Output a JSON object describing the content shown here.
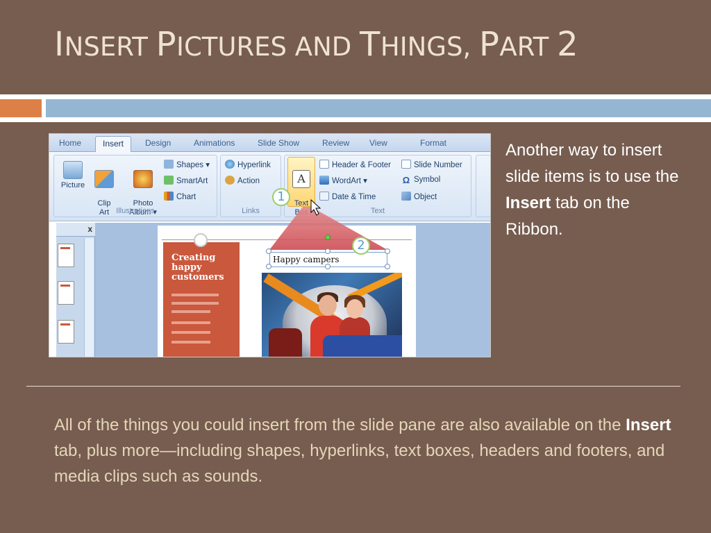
{
  "slide": {
    "title_parts": [
      {
        "big": "I",
        "small": "nsert "
      },
      {
        "big": "P",
        "small": "ictures and "
      },
      {
        "big": "T",
        "small": "hings, "
      },
      {
        "big": "P",
        "small": "art "
      },
      {
        "big": "2",
        "small": ""
      }
    ],
    "right_text": {
      "before": "Another way to insert slide items is to use the ",
      "bold": "Insert",
      "after": " tab on the Ribbon."
    },
    "bottom_text": {
      "before": "All of the things you could insert from the slide pane are also available on the ",
      "bold": "Insert",
      "after": " tab, plus more—including shapes, hyperlinks, text boxes, headers and footers, and media clips such as sounds."
    }
  },
  "screenshot": {
    "tabs": [
      "Home",
      "Insert",
      "Design",
      "Animations",
      "Slide Show",
      "Review",
      "View",
      "Format"
    ],
    "active_tab": "Insert",
    "groups": {
      "illustrations": {
        "label": "Illustrations",
        "buttons": [
          "Picture",
          "Clip\nArt",
          "Photo\nAlbum ▾"
        ],
        "small": [
          "Shapes ▾",
          "SmartArt",
          "Chart"
        ]
      },
      "links": {
        "label": "Links",
        "small": [
          "Hyperlink",
          "Action"
        ]
      },
      "text": {
        "label": "Text",
        "button": "Text\nBox",
        "small_col1": [
          "Header & Footer",
          "WordArt ▾",
          "Date & Time"
        ],
        "small_col2": [
          "Slide Number",
          "Symbol",
          "Object"
        ]
      }
    },
    "pane_close": "x",
    "slide_preview": {
      "heading": "Creating happy customers",
      "textbox": "Happy campers"
    },
    "callouts": [
      "1",
      "2"
    ],
    "colors": {
      "background": "#765d50",
      "title": "#efe3cf",
      "accent_orange": "#dd8047",
      "accent_blue": "#94b6d2",
      "bottom_text": "#e6d6b9"
    }
  }
}
